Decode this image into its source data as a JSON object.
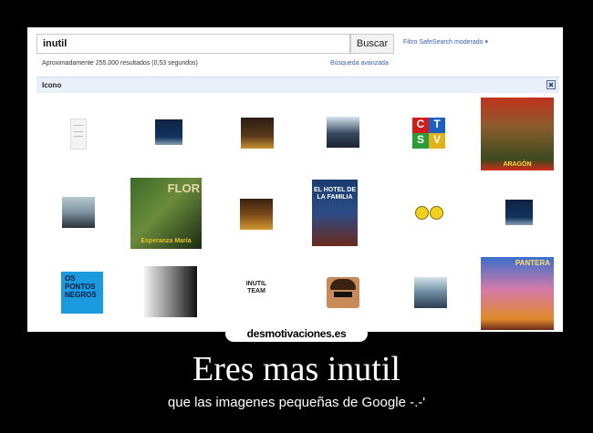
{
  "search": {
    "query": "inutil",
    "button_label": "Buscar",
    "safesearch_label": "Filtro SafeSearch moderado ▾",
    "result_stats": "Aproximadamente 255.000 resultados (0,53 segundos)",
    "advanced_search": "Búsqueda avanzada"
  },
  "filter": {
    "label": "Icono",
    "close_glyph": "✖"
  },
  "thumbs": {
    "flor": "FLOR",
    "esperanza": "Esperanza María",
    "hotel": "EL HOTEL DE LA FAMILIA",
    "aragon": "ARAGÓN",
    "pantera": "PANTERA",
    "os_pontos": "OS PONTOS NEGROS",
    "inutil_team": "INUTIL TEAM",
    "tv_letters": [
      "C",
      "T",
      "S",
      "V"
    ]
  },
  "footer": {
    "site": "desmotivaciones.es",
    "title": "Eres mas inutil",
    "subtitle": "que las imagenes pequeñas de Google -.-'"
  }
}
